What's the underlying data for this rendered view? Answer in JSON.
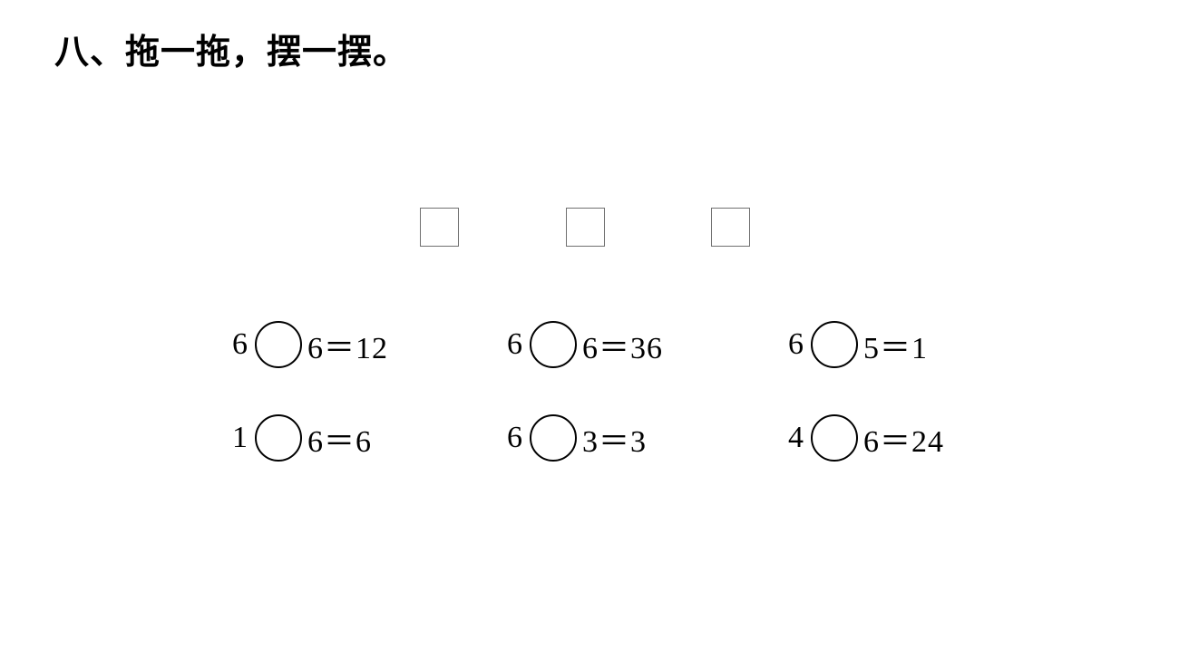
{
  "title": "八、拖一拖，摆一摆。",
  "drop_boxes": [
    "",
    "",
    ""
  ],
  "equations": [
    {
      "left": "6",
      "rest": "6＝12"
    },
    {
      "left": "6",
      "rest": "6＝36"
    },
    {
      "left": "6",
      "rest": "5＝1"
    },
    {
      "left": "1",
      "rest": "6＝6"
    },
    {
      "left": "6",
      "rest": "3＝3"
    },
    {
      "left": "4",
      "rest": "6＝24"
    }
  ]
}
